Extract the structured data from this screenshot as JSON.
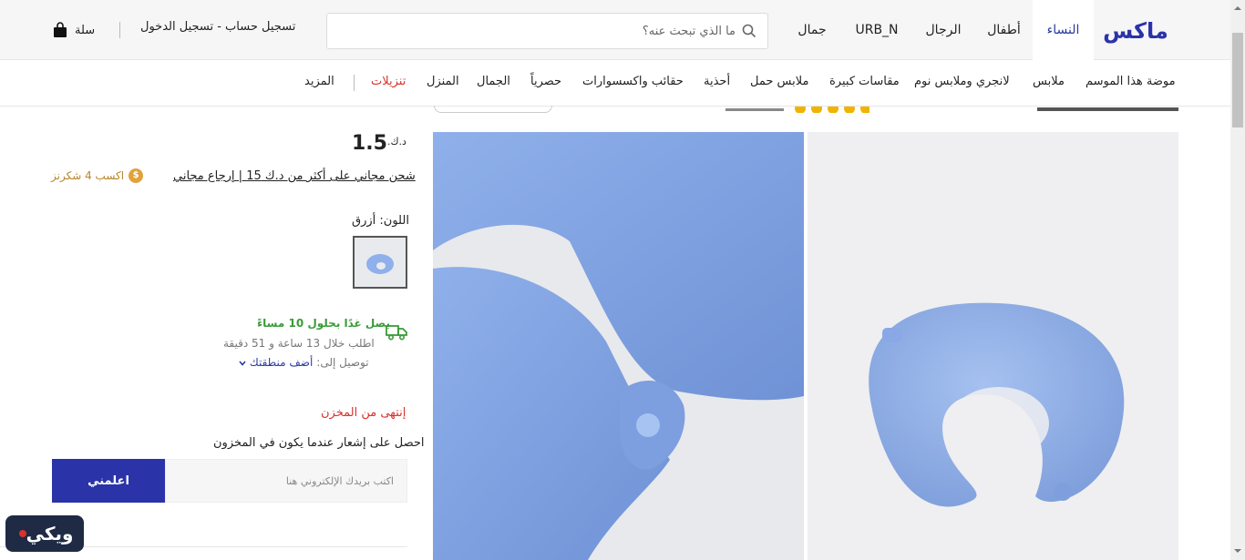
{
  "header": {
    "logo_text": "ماكس",
    "tabs": [
      {
        "label": "النساء",
        "active": true
      },
      {
        "label": "أطفال"
      },
      {
        "label": "الرجال"
      },
      {
        "label": "URB_N"
      },
      {
        "label": "جمال"
      }
    ],
    "search_placeholder": "ما الذي تبحث عنه؟",
    "auth_label": "تسجيل حساب - تسجيل الدخول",
    "cart_label": "سلة"
  },
  "categories": [
    {
      "label": "موضة هذا الموسم"
    },
    {
      "label": "ملابس"
    },
    {
      "label": "لانجري وملابس نوم"
    },
    {
      "label": "مقاسات كبيرة"
    },
    {
      "label": "ملابس حمل"
    },
    {
      "label": "أحذية"
    },
    {
      "label": "حقائب واكسسوارات"
    },
    {
      "label": "حصرياً"
    },
    {
      "label": "الجمال"
    },
    {
      "label": "المنزل"
    },
    {
      "label": "تنزيلات",
      "highlight": true
    },
    {
      "label": "المزيد"
    }
  ],
  "product": {
    "currency": "د.ك.",
    "price": "1.5",
    "shipping": "شحن مجاني على أكثر من د.ك 15 | إرجاع مجاني",
    "earn_coin": "$",
    "earn": "اكسب 4 شكرنز",
    "color_label": "اللون:",
    "color_value": "أزرق",
    "delivery_headline": "يصل غدًا بحلول 10 مساءً",
    "delivery_countdown": "اطلب خلال 13 ساعة و 51 دقيقة",
    "delivery_to_label": "توصيل إلى:",
    "delivery_to_link": "أضف منطقتك",
    "out_of_stock": "إنتهى من المخزن",
    "notify_text": "احصل على إشعار عندما يكون في المخزون",
    "email_placeholder": "اكتب بريدك الإلكتروني هنا",
    "notify_button": "اعلمني"
  },
  "watermark": "ويكي",
  "colors": {
    "brand_blue": "#2b33a8",
    "sale_red": "#d8322b",
    "delivery_green": "#3a9b3a",
    "earn_gold": "#b8862b",
    "pillow_blue": "#8fb0ea"
  }
}
